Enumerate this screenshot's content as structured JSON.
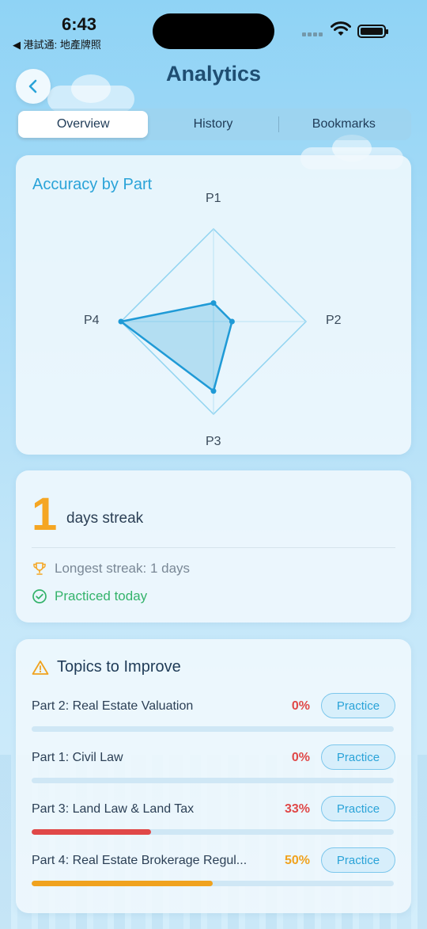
{
  "status": {
    "time": "6:43",
    "back_app": "◀ 港試通: 地產牌照"
  },
  "header": {
    "title": "Analytics",
    "back_icon": "chevron-left-icon"
  },
  "tabs": [
    {
      "label": "Overview",
      "active": true
    },
    {
      "label": "History",
      "active": false
    },
    {
      "label": "Bookmarks",
      "active": false
    }
  ],
  "radar": {
    "title": "Accuracy by Part",
    "axes": [
      "P1",
      "P2",
      "P3",
      "P4"
    ],
    "values": [
      0.2,
      0.2,
      0.75,
      1.0
    ]
  },
  "streak": {
    "count": "1",
    "label": "days streak",
    "longest": "Longest streak: 1 days",
    "practiced": "Practiced today",
    "trophy_icon": "trophy-icon",
    "check_icon": "check-circle-icon"
  },
  "topics": {
    "title": "Topics to Improve",
    "warning_icon": "warning-triangle-icon",
    "button_label": "Practice",
    "items": [
      {
        "name": "Part 2: Real Estate Valuation",
        "percent": "0%",
        "value": 0,
        "color": "#e04848"
      },
      {
        "name": "Part 1: Civil Law",
        "percent": "0%",
        "value": 0,
        "color": "#e04848"
      },
      {
        "name": "Part 3: Land Law & Land Tax",
        "percent": "33%",
        "value": 0.33,
        "color": "#e04848"
      },
      {
        "name": "Part 4: Real Estate Brokerage Regul...",
        "percent": "50%",
        "value": 0.5,
        "color": "#f0a21e"
      }
    ]
  },
  "colors": {
    "accent": "#2aa3d8",
    "streak": "#f5a623",
    "success": "#34b36b",
    "danger": "#e04848",
    "warning": "#f0a21e"
  }
}
